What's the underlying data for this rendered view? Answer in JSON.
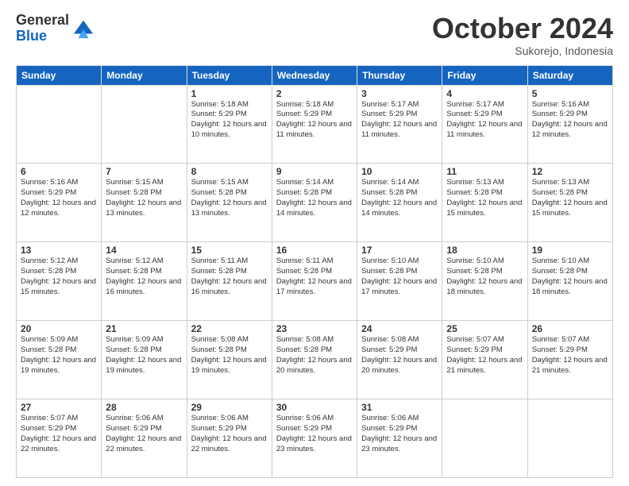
{
  "logo": {
    "general": "General",
    "blue": "Blue"
  },
  "header": {
    "month": "October 2024",
    "location": "Sukorejo, Indonesia"
  },
  "weekdays": [
    "Sunday",
    "Monday",
    "Tuesday",
    "Wednesday",
    "Thursday",
    "Friday",
    "Saturday"
  ],
  "weeks": [
    [
      {
        "day": "",
        "info": ""
      },
      {
        "day": "",
        "info": ""
      },
      {
        "day": "1",
        "info": "Sunrise: 5:18 AM\nSunset: 5:29 PM\nDaylight: 12 hours and 10 minutes."
      },
      {
        "day": "2",
        "info": "Sunrise: 5:18 AM\nSunset: 5:29 PM\nDaylight: 12 hours and 11 minutes."
      },
      {
        "day": "3",
        "info": "Sunrise: 5:17 AM\nSunset: 5:29 PM\nDaylight: 12 hours and 11 minutes."
      },
      {
        "day": "4",
        "info": "Sunrise: 5:17 AM\nSunset: 5:29 PM\nDaylight: 12 hours and 11 minutes."
      },
      {
        "day": "5",
        "info": "Sunrise: 5:16 AM\nSunset: 5:29 PM\nDaylight: 12 hours and 12 minutes."
      }
    ],
    [
      {
        "day": "6",
        "info": "Sunrise: 5:16 AM\nSunset: 5:29 PM\nDaylight: 12 hours and 12 minutes."
      },
      {
        "day": "7",
        "info": "Sunrise: 5:15 AM\nSunset: 5:28 PM\nDaylight: 12 hours and 13 minutes."
      },
      {
        "day": "8",
        "info": "Sunrise: 5:15 AM\nSunset: 5:28 PM\nDaylight: 12 hours and 13 minutes."
      },
      {
        "day": "9",
        "info": "Sunrise: 5:14 AM\nSunset: 5:28 PM\nDaylight: 12 hours and 14 minutes."
      },
      {
        "day": "10",
        "info": "Sunrise: 5:14 AM\nSunset: 5:28 PM\nDaylight: 12 hours and 14 minutes."
      },
      {
        "day": "11",
        "info": "Sunrise: 5:13 AM\nSunset: 5:28 PM\nDaylight: 12 hours and 15 minutes."
      },
      {
        "day": "12",
        "info": "Sunrise: 5:13 AM\nSunset: 5:28 PM\nDaylight: 12 hours and 15 minutes."
      }
    ],
    [
      {
        "day": "13",
        "info": "Sunrise: 5:12 AM\nSunset: 5:28 PM\nDaylight: 12 hours and 15 minutes."
      },
      {
        "day": "14",
        "info": "Sunrise: 5:12 AM\nSunset: 5:28 PM\nDaylight: 12 hours and 16 minutes."
      },
      {
        "day": "15",
        "info": "Sunrise: 5:11 AM\nSunset: 5:28 PM\nDaylight: 12 hours and 16 minutes."
      },
      {
        "day": "16",
        "info": "Sunrise: 5:11 AM\nSunset: 5:28 PM\nDaylight: 12 hours and 17 minutes."
      },
      {
        "day": "17",
        "info": "Sunrise: 5:10 AM\nSunset: 5:28 PM\nDaylight: 12 hours and 17 minutes."
      },
      {
        "day": "18",
        "info": "Sunrise: 5:10 AM\nSunset: 5:28 PM\nDaylight: 12 hours and 18 minutes."
      },
      {
        "day": "19",
        "info": "Sunrise: 5:10 AM\nSunset: 5:28 PM\nDaylight: 12 hours and 18 minutes."
      }
    ],
    [
      {
        "day": "20",
        "info": "Sunrise: 5:09 AM\nSunset: 5:28 PM\nDaylight: 12 hours and 19 minutes."
      },
      {
        "day": "21",
        "info": "Sunrise: 5:09 AM\nSunset: 5:28 PM\nDaylight: 12 hours and 19 minutes."
      },
      {
        "day": "22",
        "info": "Sunrise: 5:08 AM\nSunset: 5:28 PM\nDaylight: 12 hours and 19 minutes."
      },
      {
        "day": "23",
        "info": "Sunrise: 5:08 AM\nSunset: 5:28 PM\nDaylight: 12 hours and 20 minutes."
      },
      {
        "day": "24",
        "info": "Sunrise: 5:08 AM\nSunset: 5:29 PM\nDaylight: 12 hours and 20 minutes."
      },
      {
        "day": "25",
        "info": "Sunrise: 5:07 AM\nSunset: 5:29 PM\nDaylight: 12 hours and 21 minutes."
      },
      {
        "day": "26",
        "info": "Sunrise: 5:07 AM\nSunset: 5:29 PM\nDaylight: 12 hours and 21 minutes."
      }
    ],
    [
      {
        "day": "27",
        "info": "Sunrise: 5:07 AM\nSunset: 5:29 PM\nDaylight: 12 hours and 22 minutes."
      },
      {
        "day": "28",
        "info": "Sunrise: 5:06 AM\nSunset: 5:29 PM\nDaylight: 12 hours and 22 minutes."
      },
      {
        "day": "29",
        "info": "Sunrise: 5:06 AM\nSunset: 5:29 PM\nDaylight: 12 hours and 22 minutes."
      },
      {
        "day": "30",
        "info": "Sunrise: 5:06 AM\nSunset: 5:29 PM\nDaylight: 12 hours and 23 minutes."
      },
      {
        "day": "31",
        "info": "Sunrise: 5:06 AM\nSunset: 5:29 PM\nDaylight: 12 hours and 23 minutes."
      },
      {
        "day": "",
        "info": ""
      },
      {
        "day": "",
        "info": ""
      }
    ]
  ]
}
